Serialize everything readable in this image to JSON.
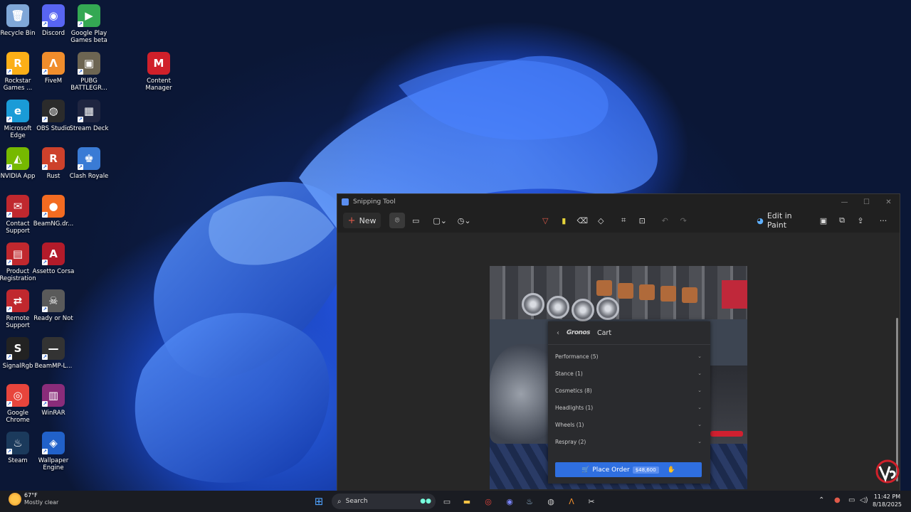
{
  "desktop_icons": [
    {
      "label": "Recycle Bin",
      "glyph": "🗑",
      "color": "#7fa7d8",
      "shortcut": false
    },
    {
      "label": "Discord",
      "glyph": "◉",
      "color": "#5865f2",
      "shortcut": true
    },
    {
      "label": "Google Play Games beta",
      "glyph": "▶",
      "color": "#34a853",
      "shortcut": true
    },
    {
      "label": "Rockstar Games ...",
      "glyph": "R",
      "color": "#fcaf17",
      "shortcut": true
    },
    {
      "label": "FiveM",
      "glyph": "Λ",
      "color": "#f08d2c",
      "shortcut": true
    },
    {
      "label": "PUBG BATTLEGR...",
      "glyph": "▣",
      "color": "#6d6552",
      "shortcut": true
    },
    {
      "label": "Content Manager",
      "glyph": "M",
      "color": "#d0202a",
      "shortcut": false
    },
    {
      "label": "Microsoft Edge",
      "glyph": "e",
      "color": "#1a9bd7",
      "shortcut": true
    },
    {
      "label": "OBS Studio",
      "glyph": "◍",
      "color": "#2b2b2b",
      "shortcut": true
    },
    {
      "label": "Stream Deck",
      "glyph": "▦",
      "color": "#1f2540",
      "shortcut": true
    },
    {
      "label": "NVIDIA App",
      "glyph": "◭",
      "color": "#76b900",
      "shortcut": true
    },
    {
      "label": "Rust",
      "glyph": "R",
      "color": "#cd412b",
      "shortcut": true
    },
    {
      "label": "Clash Royale",
      "glyph": "♚",
      "color": "#3a7bd5",
      "shortcut": true
    },
    {
      "label": "Contact Support",
      "glyph": "✉",
      "color": "#c0282e",
      "shortcut": true
    },
    {
      "label": "BeamNG.dr...",
      "glyph": "●",
      "color": "#f36b21",
      "shortcut": true
    },
    {
      "label": "Product Registration",
      "glyph": "▤",
      "color": "#c0282e",
      "shortcut": true
    },
    {
      "label": "Assetto Corsa",
      "glyph": "A",
      "color": "#b31b2a",
      "shortcut": true
    },
    {
      "label": "Remote Support",
      "glyph": "⇄",
      "color": "#c0282e",
      "shortcut": true
    },
    {
      "label": "Ready or Not",
      "glyph": "☠",
      "color": "#5a5a5a",
      "shortcut": true
    },
    {
      "label": "SignalRgb",
      "glyph": "S",
      "color": "#222222",
      "shortcut": true
    },
    {
      "label": "BeamMP-L...",
      "glyph": "—",
      "color": "#333333",
      "shortcut": true
    },
    {
      "label": "Google Chrome",
      "glyph": "◎",
      "color": "#e8453c",
      "shortcut": true
    },
    {
      "label": "WinRAR",
      "glyph": "▥",
      "color": "#8a2c7a",
      "shortcut": true
    },
    {
      "label": "Steam",
      "glyph": "♨",
      "color": "#1b3a5c",
      "shortcut": true
    },
    {
      "label": "Wallpaper Engine",
      "glyph": "◈",
      "color": "#2161c9",
      "shortcut": true
    }
  ],
  "snipping_tool": {
    "title": "Snipping Tool",
    "window_controls": {
      "minimize": "—",
      "maximize": "☐",
      "close": "✕"
    },
    "toolbar": {
      "new_label": "New",
      "edit_in_paint_label": "Edit in Paint"
    },
    "capture": {
      "cart_title": "Cart",
      "brand_logo": "Gronos",
      "rows": [
        "Performance (5)",
        "Stance (1)",
        "Cosmetics (8)",
        "Headlights (1)",
        "Wheels (1)",
        "Respray (2)"
      ],
      "place_order_label": "Place Order",
      "price": "$48,600"
    }
  },
  "taskbar": {
    "weather_temp": "67°F",
    "weather_desc": "Mostly clear",
    "search_placeholder": "Search",
    "time": "11:42 PM",
    "date": "8/18/2025"
  }
}
